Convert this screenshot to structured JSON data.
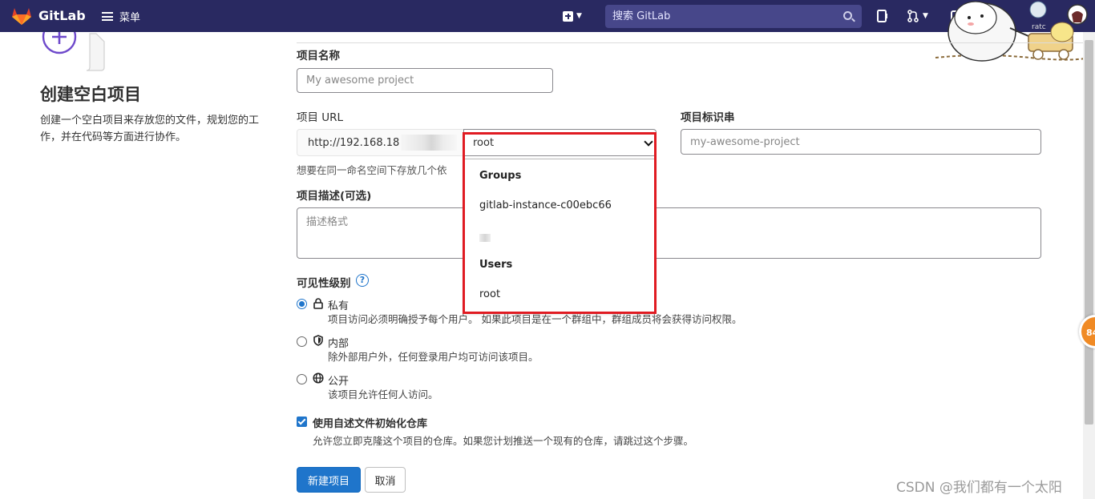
{
  "navbar": {
    "brand": "GitLab",
    "menu_label": "菜单",
    "search_placeholder": "搜索 GitLab",
    "user_text": "ratc"
  },
  "left": {
    "title": "创建空白项目",
    "description": "创建一个空白项目来存放您的文件，规划您的工作，并在代码等方面进行协作。"
  },
  "form": {
    "name_label": "项目名称",
    "name_placeholder": "My awesome project",
    "url_label": "项目 URL",
    "url_prefix": "http://192.168.18",
    "namespace_selected": "root",
    "slug_label": "项目标识串",
    "slug_placeholder": "my-awesome-project",
    "help_text": "想要在同一命名空间下存放几个依",
    "desc_label": "项目描述(可选)",
    "desc_placeholder": "描述格式"
  },
  "dropdown": {
    "groups_header": "Groups",
    "groups": [
      "gitlab-instance-c00ebc66"
    ],
    "users_header": "Users",
    "users": [
      "root"
    ]
  },
  "visibility": {
    "label": "可见性级别",
    "help_mark": "?",
    "options": [
      {
        "title": "私有",
        "desc": "项目访问必须明确授予每个用户。 如果此项目是在一个群组中，群组成员将会获得访问权限。",
        "checked": true,
        "icon": "lock-icon"
      },
      {
        "title": "内部",
        "desc": "除外部用户外，任何登录用户均可访问该项目。",
        "checked": false,
        "icon": "shield-icon"
      },
      {
        "title": "公开",
        "desc": "该项目允许任何人访问。",
        "checked": false,
        "icon": "globe-icon"
      }
    ]
  },
  "readme": {
    "title": "使用自述文件初始化仓库",
    "desc": "允许您立即克隆这个项目的仓库。如果您计划推送一个现有的仓库，请跳过这个步骤。",
    "checked": true
  },
  "buttons": {
    "create": "新建项目",
    "cancel": "取消"
  },
  "float_badge": "84",
  "watermark": "CSDN @我们都有一个太阳",
  "colors": {
    "navbar": "#292961",
    "primary": "#1f75cb",
    "highlight": "#e01b22"
  }
}
